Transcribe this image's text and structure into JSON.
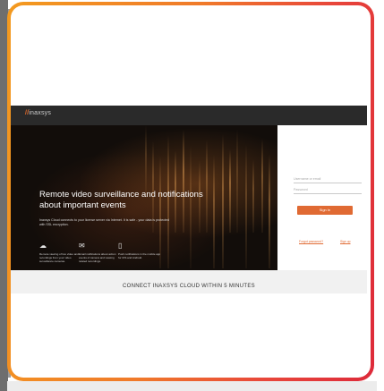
{
  "brand": {
    "logo_mark": "//",
    "logo_text": "inaxsys"
  },
  "hero": {
    "title": "Remote video surveillance and notifications about important events",
    "description": "Inaxsys Cloud connects to your license server via Internet. It is safe - your data is protected with SSL encryption."
  },
  "features": [
    {
      "icon": "cloud-icon",
      "glyph": "☁",
      "text": "Remote viewing of live video and recordings from your video surveillance cameras."
    },
    {
      "icon": "envelope-icon",
      "glyph": "✉",
      "text": "Email notifications about action events of camera and viewing related recordings."
    },
    {
      "icon": "phone-icon",
      "glyph": "▯",
      "text": "Push notifications in the mobile app for iOS and Android."
    }
  ],
  "login": {
    "username_placeholder": "Username or email",
    "password_placeholder": "Password",
    "signin_label": "Sign In",
    "forgot_label": "Forgot password?",
    "signup_label": "Sign up"
  },
  "footer": {
    "connect_heading": "CONNECT INAXSYS CLOUD WITHIN 5 MINUTES"
  },
  "colors": {
    "accent": "#e06a33",
    "navbar": "#2a2a2a",
    "frame_start": "#f39a1f",
    "frame_end": "#dd2a3a"
  }
}
